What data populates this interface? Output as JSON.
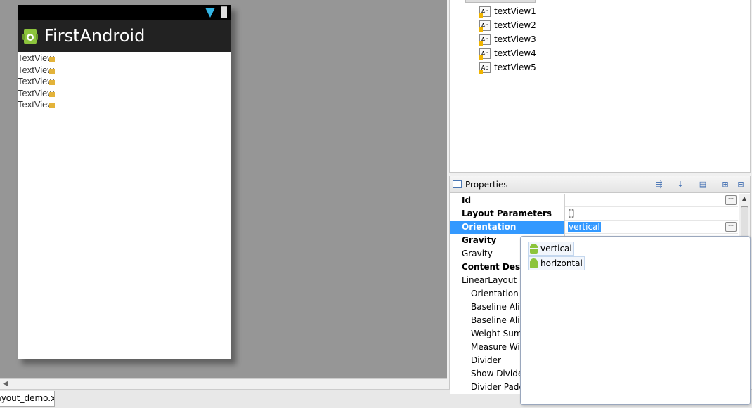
{
  "canvas": {
    "phone": {
      "app_title": "FirstAndroid",
      "text_views": [
        "TextView",
        "TextView",
        "TextView",
        "TextView",
        "TextView"
      ]
    }
  },
  "editor_tab": {
    "label": "layout_demo.xml"
  },
  "outline": {
    "items": [
      "textView1",
      "textView2",
      "textView3",
      "textView4",
      "textView5"
    ]
  },
  "properties": {
    "title": "Properties",
    "rows": [
      {
        "name": "Id",
        "value": ""
      },
      {
        "name": "Layout Parameters",
        "value": "[]"
      },
      {
        "name": "Orientation",
        "value": "vertical"
      },
      {
        "name": "Gravity",
        "value": ""
      },
      {
        "name": "Gravity",
        "value": ""
      },
      {
        "name": "Content Description",
        "value": ""
      },
      {
        "name": "LinearLayout",
        "value": ""
      },
      {
        "name": "Orientation",
        "value": ""
      },
      {
        "name": "Baseline Aligned",
        "value": ""
      },
      {
        "name": "Baseline Aligned Child Index",
        "value": ""
      },
      {
        "name": "Weight Sum",
        "value": ""
      },
      {
        "name": "Measure With Largest Child",
        "value": ""
      },
      {
        "name": "Divider",
        "value": ""
      },
      {
        "name": "Show Dividers",
        "value": ""
      },
      {
        "name": "Divider Padding",
        "value": ""
      }
    ]
  },
  "dropdown": {
    "options": [
      "vertical",
      "horizontal"
    ]
  },
  "colors": {
    "selection": "#3399ff",
    "android_green": "#8cc43c",
    "canvas_gray": "#969696"
  }
}
